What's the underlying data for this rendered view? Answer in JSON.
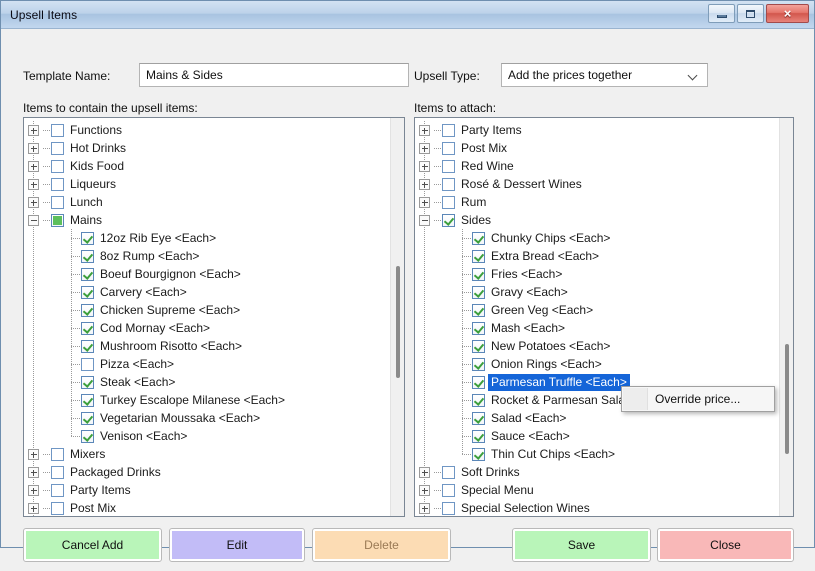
{
  "window": {
    "title": "Upsell Items",
    "controls": {
      "minimize": "minimize-button",
      "maximize": "maximize-button",
      "close": "×"
    }
  },
  "form": {
    "template_name_label": "Template Name:",
    "template_name_value": "Mains & Sides",
    "upsell_type_label": "Upsell Type:",
    "upsell_type_value": "Add the prices together",
    "left_panel_label": "Items to contain the upsell items:",
    "right_panel_label": "Items to attach:"
  },
  "left_tree": [
    {
      "label": "Functions",
      "level": 0,
      "state": "unchecked",
      "expander": "plus"
    },
    {
      "label": "Hot Drinks",
      "level": 0,
      "state": "unchecked",
      "expander": "plus"
    },
    {
      "label": "Kids Food",
      "level": 0,
      "state": "unchecked",
      "expander": "plus"
    },
    {
      "label": "Liqueurs",
      "level": 0,
      "state": "unchecked",
      "expander": "plus"
    },
    {
      "label": "Lunch",
      "level": 0,
      "state": "unchecked",
      "expander": "plus"
    },
    {
      "label": "Mains",
      "level": 0,
      "state": "partial",
      "expander": "minus"
    },
    {
      "label": "12oz Rib Eye <Each>",
      "level": 1,
      "state": "checked",
      "expander": "none"
    },
    {
      "label": "8oz Rump <Each>",
      "level": 1,
      "state": "checked",
      "expander": "none"
    },
    {
      "label": "Boeuf Bourgignon <Each>",
      "level": 1,
      "state": "checked",
      "expander": "none"
    },
    {
      "label": "Carvery <Each>",
      "level": 1,
      "state": "checked",
      "expander": "none"
    },
    {
      "label": "Chicken Supreme <Each>",
      "level": 1,
      "state": "checked",
      "expander": "none"
    },
    {
      "label": "Cod Mornay <Each>",
      "level": 1,
      "state": "checked",
      "expander": "none"
    },
    {
      "label": "Mushroom Risotto <Each>",
      "level": 1,
      "state": "checked",
      "expander": "none"
    },
    {
      "label": "Pizza <Each>",
      "level": 1,
      "state": "unchecked",
      "expander": "none"
    },
    {
      "label": "Steak <Each>",
      "level": 1,
      "state": "checked",
      "expander": "none"
    },
    {
      "label": "Turkey Escalope Milanese <Each>",
      "level": 1,
      "state": "checked",
      "expander": "none"
    },
    {
      "label": "Vegetarian Moussaka <Each>",
      "level": 1,
      "state": "checked",
      "expander": "none"
    },
    {
      "label": "Venison <Each>",
      "level": 1,
      "state": "checked",
      "expander": "last"
    },
    {
      "label": "Mixers",
      "level": 0,
      "state": "unchecked",
      "expander": "plus"
    },
    {
      "label": "Packaged Drinks",
      "level": 0,
      "state": "unchecked",
      "expander": "plus"
    },
    {
      "label": "Party Items",
      "level": 0,
      "state": "unchecked",
      "expander": "plus"
    },
    {
      "label": "Post Mix",
      "level": 0,
      "state": "unchecked",
      "expander": "plus"
    }
  ],
  "right_tree": [
    {
      "label": "Party Items",
      "level": 0,
      "state": "unchecked",
      "expander": "plus"
    },
    {
      "label": "Post Mix",
      "level": 0,
      "state": "unchecked",
      "expander": "plus"
    },
    {
      "label": "Red Wine",
      "level": 0,
      "state": "unchecked",
      "expander": "plus"
    },
    {
      "label": "Rosé & Dessert Wines",
      "level": 0,
      "state": "unchecked",
      "expander": "plus"
    },
    {
      "label": "Rum",
      "level": 0,
      "state": "unchecked",
      "expander": "plus"
    },
    {
      "label": "Sides",
      "level": 0,
      "state": "checked",
      "expander": "minus"
    },
    {
      "label": "Chunky Chips <Each>",
      "level": 1,
      "state": "checked",
      "expander": "none"
    },
    {
      "label": "Extra Bread <Each>",
      "level": 1,
      "state": "checked",
      "expander": "none"
    },
    {
      "label": "Fries <Each>",
      "level": 1,
      "state": "checked",
      "expander": "none"
    },
    {
      "label": "Gravy <Each>",
      "level": 1,
      "state": "checked",
      "expander": "none"
    },
    {
      "label": "Green Veg <Each>",
      "level": 1,
      "state": "checked",
      "expander": "none"
    },
    {
      "label": "Mash <Each>",
      "level": 1,
      "state": "checked",
      "expander": "none"
    },
    {
      "label": "New Potatoes <Each>",
      "level": 1,
      "state": "checked",
      "expander": "none"
    },
    {
      "label": "Onion Rings <Each>",
      "level": 1,
      "state": "checked",
      "expander": "none"
    },
    {
      "label": "Parmesan Truffle <Each>",
      "level": 1,
      "state": "checked",
      "expander": "none",
      "selected": true
    },
    {
      "label": "Rocket & Parmesan Salad <Each>",
      "level": 1,
      "state": "checked",
      "expander": "none"
    },
    {
      "label": "Salad <Each>",
      "level": 1,
      "state": "checked",
      "expander": "none"
    },
    {
      "label": "Sauce <Each>",
      "level": 1,
      "state": "checked",
      "expander": "none"
    },
    {
      "label": "Thin Cut Chips <Each>",
      "level": 1,
      "state": "checked",
      "expander": "last"
    },
    {
      "label": "Soft Drinks",
      "level": 0,
      "state": "unchecked",
      "expander": "plus"
    },
    {
      "label": "Special Menu",
      "level": 0,
      "state": "unchecked",
      "expander": "plus"
    },
    {
      "label": "Special Selection Wines",
      "level": 0,
      "state": "unchecked",
      "expander": "plus"
    }
  ],
  "context_menu": {
    "items": [
      {
        "label": "Override price..."
      }
    ]
  },
  "buttons": {
    "cancel_add": "Cancel Add",
    "edit": "Edit",
    "delete": "Delete",
    "save": "Save",
    "close": "Close"
  },
  "colors": {
    "selection": "#1565d8",
    "checkmark": "#3c9f3c",
    "partial_fill": "#5cbf5c",
    "btn_cancel_add": "#b9f5b9",
    "btn_edit": "#c2bcf7",
    "btn_delete": "#fcdcb4",
    "btn_save": "#b9f5b9",
    "btn_close": "#f9b8b8",
    "titlebar": "#bcd2ea"
  }
}
